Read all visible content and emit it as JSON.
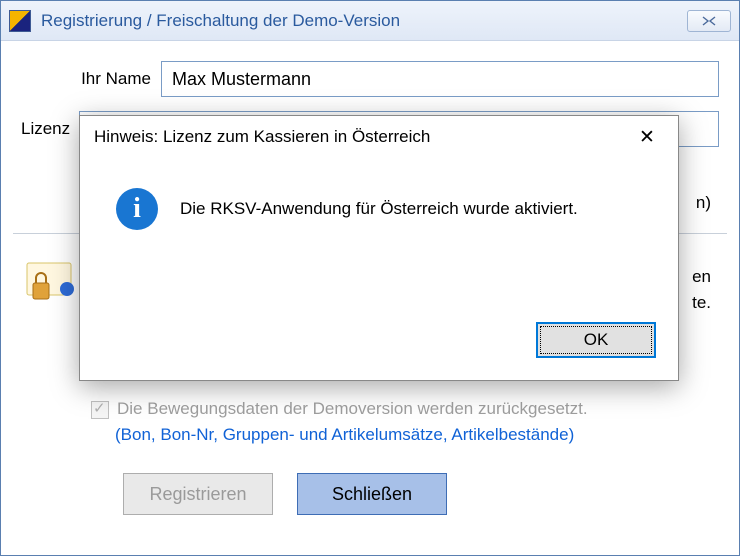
{
  "window": {
    "title": "Registrierung / Freischaltung der Demo-Version",
    "close_glyph": "✕"
  },
  "form": {
    "name_label": "Ihr Name",
    "name_value": "Max Mustermann",
    "lizenz_label": "Lizenz",
    "button_frag_right": "n)"
  },
  "fragments": {
    "en": "en",
    "te": "te."
  },
  "reset": {
    "checkbox_label": "Die Bewegungsdaten der Demoversion werden zurückgesetzt.",
    "checkbox_checked": true,
    "sublabel": "(Bon, Bon-Nr, Gruppen- und Artikelumsätze, Artikelbestände)"
  },
  "buttons": {
    "register": "Registrieren",
    "close": "Schließen"
  },
  "modal": {
    "title": "Hinweis: Lizenz zum Kassieren in Österreich",
    "message": "Die RKSV-Anwendung für Österreich wurde aktiviert.",
    "ok": "OK",
    "close_glyph": "✕",
    "info_glyph": "i"
  }
}
